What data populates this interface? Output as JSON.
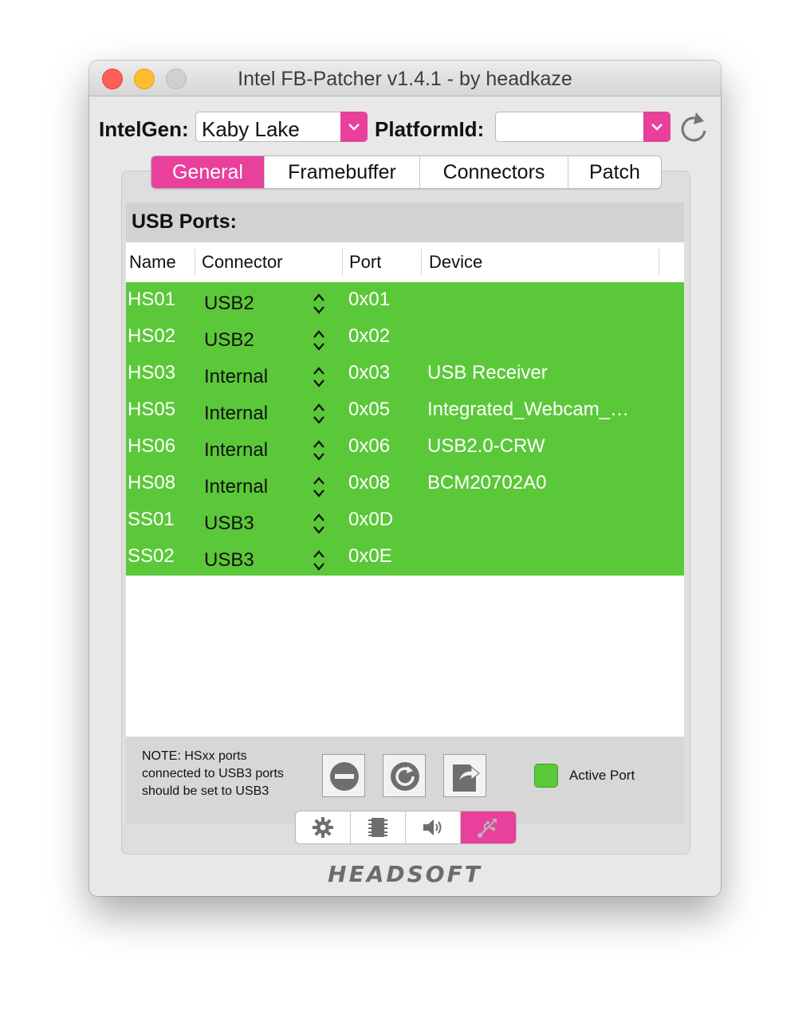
{
  "window": {
    "title": "Intel FB-Patcher v1.4.1 - by headkaze"
  },
  "toolbar": {
    "intelgen_label": "IntelGen:",
    "intelgen_value": "Kaby Lake",
    "platformid_label": "PlatformId:",
    "platformid_value": ""
  },
  "tabs": [
    {
      "label": "General",
      "active": true
    },
    {
      "label": "Framebuffer",
      "active": false
    },
    {
      "label": "Connectors",
      "active": false
    },
    {
      "label": "Patch",
      "active": false
    }
  ],
  "usb_section": {
    "title": "USB Ports:",
    "columns": [
      "Name",
      "Connector",
      "Port",
      "Device"
    ],
    "rows": [
      {
        "name": "HS01",
        "connector": "USB2",
        "port": "0x01",
        "device": ""
      },
      {
        "name": "HS02",
        "connector": "USB2",
        "port": "0x02",
        "device": ""
      },
      {
        "name": "HS03",
        "connector": "Internal",
        "port": "0x03",
        "device": "USB Receiver"
      },
      {
        "name": "HS05",
        "connector": "Internal",
        "port": "0x05",
        "device": "Integrated_Webcam_…"
      },
      {
        "name": "HS06",
        "connector": "Internal",
        "port": "0x06",
        "device": "USB2.0-CRW"
      },
      {
        "name": "HS08",
        "connector": "Internal",
        "port": "0x08",
        "device": "BCM20702A0"
      },
      {
        "name": "SS01",
        "connector": "USB3",
        "port": "0x0D",
        "device": ""
      },
      {
        "name": "SS02",
        "connector": "USB3",
        "port": "0x0E",
        "device": ""
      }
    ]
  },
  "note": {
    "line1": "NOTE: HSxx ports",
    "line2": "connected to USB3 ports",
    "line3": "should be set to USB3"
  },
  "legend": {
    "label": "Active Port",
    "color": "#5bc839"
  },
  "bottom_tabs": [
    "gear-icon",
    "chip-icon",
    "speaker-icon",
    "usb-icon"
  ],
  "logo_text": "HEADSOFT",
  "colors": {
    "accent": "#e8409b",
    "active_port": "#5bc839"
  }
}
